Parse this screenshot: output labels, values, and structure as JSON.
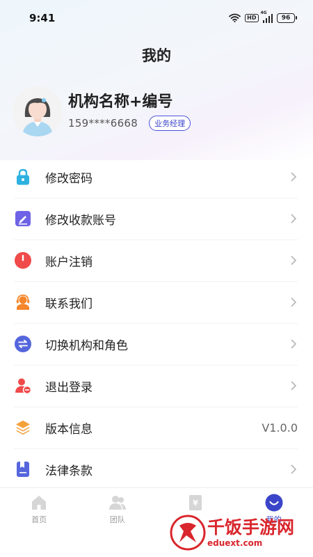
{
  "status_bar": {
    "time": "9:41",
    "hd_label": "HD",
    "network_label": "4G",
    "battery": "96",
    "icons": [
      "wifi-icon",
      "hd-icon",
      "signal-icon",
      "battery-icon"
    ]
  },
  "header": {
    "title": "我的"
  },
  "profile": {
    "org_name": "机构名称+编号",
    "phone": "159****6668",
    "role": "业务经理"
  },
  "menu": [
    {
      "label": "修改密码",
      "icon": "lock-icon",
      "color": "#2db1e0",
      "right": ""
    },
    {
      "label": "修改收款账号",
      "icon": "edit-icon",
      "color": "#6e63e6",
      "right": ""
    },
    {
      "label": "账户注销",
      "icon": "power-icon",
      "color": "#f04a4a",
      "right": ""
    },
    {
      "label": "联系我们",
      "icon": "headset-icon",
      "color": "#f5862a",
      "right": ""
    },
    {
      "label": "切换机构和角色",
      "icon": "switch-icon",
      "color": "#5566dd",
      "right": ""
    },
    {
      "label": "退出登录",
      "icon": "logout-icon",
      "color": "#f04a4a",
      "right": ""
    },
    {
      "label": "版本信息",
      "icon": "layers-icon",
      "color": "#f5a13a",
      "right": "V1.0.0"
    },
    {
      "label": "法律条款",
      "icon": "bookmark-icon",
      "color": "#5566dd",
      "right": ""
    }
  ],
  "tabs": [
    {
      "label": "首页",
      "icon": "home-icon",
      "active": false
    },
    {
      "label": "团队",
      "icon": "team-icon",
      "active": false
    },
    {
      "label": "",
      "icon": "money-icon",
      "active": false
    },
    {
      "label": "我的",
      "icon": "profile-icon",
      "active": true
    }
  ],
  "watermark": {
    "title": "千饭手游网",
    "url": "eduext.com"
  },
  "colors": {
    "accent": "#3b45c9",
    "divider": "#f2f2f2"
  }
}
